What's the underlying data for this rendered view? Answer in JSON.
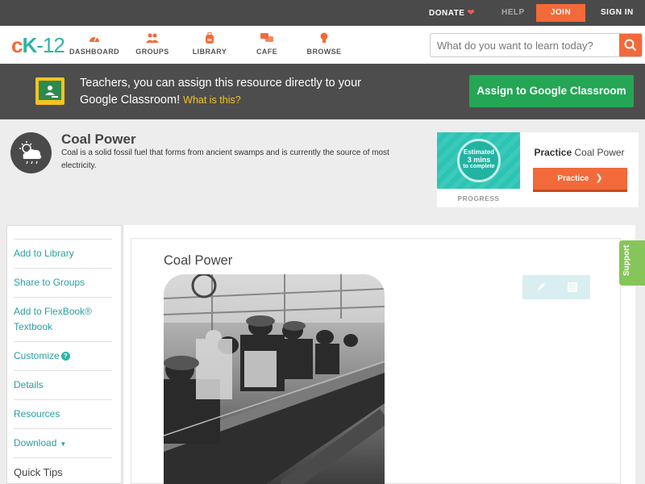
{
  "topbar": {
    "donate": "DONATE",
    "help": "HELP",
    "join": "JOIN",
    "signin": "SIGN IN"
  },
  "logo": {
    "c": "c",
    "k": "K",
    "n": "-12"
  },
  "nav": {
    "items": [
      {
        "label": "DASHBOARD",
        "icon": "gauge-icon"
      },
      {
        "label": "GROUPS",
        "icon": "people-icon"
      },
      {
        "label": "LIBRARY",
        "icon": "backpack-icon"
      },
      {
        "label": "CAFE",
        "icon": "chat-bubbles-icon"
      },
      {
        "label": "BROWSE",
        "icon": "lightbulb-icon"
      }
    ],
    "search_placeholder": "What do you want to learn today?"
  },
  "banner": {
    "text": "Teachers, you can assign this resource directly to your Google Classroom!",
    "link": "What is this?",
    "button": "Assign to Google Classroom"
  },
  "concept": {
    "title": "Coal Power",
    "description": "Coal is a solid fossil fuel that forms from ancient swamps and is currently the source of most electricity.",
    "progress": {
      "line1": "Estimated",
      "line2": "3 mins",
      "line3": "to complete",
      "label": "PROGRESS"
    },
    "practice": {
      "title_bold": "Practice",
      "title_rest": "Coal Power",
      "button": "Practice"
    }
  },
  "sidebar": {
    "items": [
      "Add to Library",
      "Share to Groups",
      "Add to FlexBook® Textbook",
      "Customize",
      "Details",
      "Resources",
      "Download",
      "Quick Tips"
    ]
  },
  "article": {
    "title": "Coal Power"
  },
  "support": "Support",
  "colors": {
    "brand_orange": "#f26a3a",
    "brand_teal": "#2cb5a8",
    "classroom_green": "#24a654",
    "support_green": "#86c55a"
  }
}
